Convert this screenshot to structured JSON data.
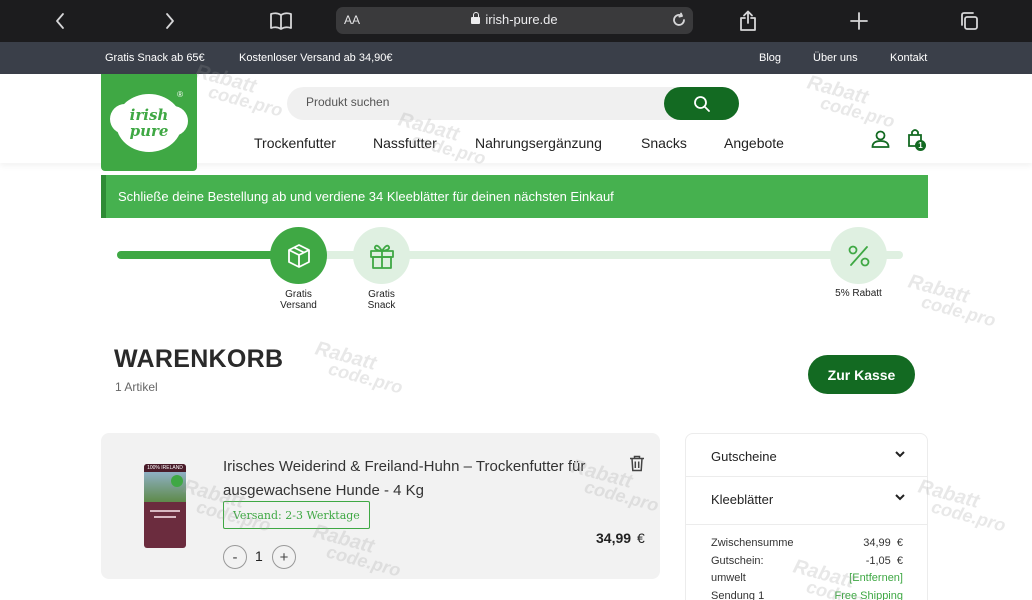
{
  "browser": {
    "url_host": "irish-pure.de",
    "text_size_label": "AA",
    "icons": [
      "chevron-left-icon",
      "chevron-right-icon",
      "book-icon",
      "lock-icon",
      "reload-icon",
      "share-icon",
      "plus-icon",
      "tabs-icon"
    ]
  },
  "promo_bar": {
    "left": [
      "Gratis Snack ab 65€",
      "Kostenloser Versand ab 34,90€"
    ],
    "right": [
      "Blog",
      "Über uns",
      "Kontakt"
    ]
  },
  "header": {
    "logo_text_1": "irish",
    "logo_text_2": "pure",
    "logo_registered": "®",
    "search_placeholder": "Produkt suchen",
    "nav": [
      "Trockenfutter",
      "Nassfutter",
      "Nahrungsergänzung",
      "Snacks",
      "Angebote"
    ],
    "cart_count": "1"
  },
  "banner": {
    "text": "Schließe deine Bestellung ab und verdiene 34 Kleeblätter für deinen nächsten Einkauf"
  },
  "progress": {
    "fill_fraction": 0.24,
    "milestones": [
      {
        "label_1": "Gratis",
        "label_2": "Versand",
        "icon": "box-icon",
        "reached": true
      },
      {
        "label_1": "Gratis",
        "label_2": "Snack",
        "icon": "gift-icon",
        "reached": false
      },
      {
        "label_1": "5% Rabatt",
        "label_2": "",
        "icon": "percent-icon",
        "reached": false
      }
    ]
  },
  "cart": {
    "title": "WARENKORB",
    "count": "1 Artikel",
    "checkout_label": "Zur Kasse"
  },
  "item": {
    "name": "Irisches Weiderind & Freiland-Huhn – Trockenfutter für ausgewachsene Hunde - 4 Kg",
    "bag_top_text": "100% IRELAND",
    "shipping": "Versand: 2-3 Werktage",
    "quantity": "1",
    "price": "34,99",
    "currency": "€"
  },
  "summary": {
    "vouchers_label": "Gutscheine",
    "clover_label": "Kleeblätter",
    "rows": [
      {
        "label": "Zwischensumme",
        "value": "34,99  €"
      },
      {
        "label": "Gutschein:",
        "value": "-1,05  €"
      },
      {
        "label": "umwelt",
        "value": "[Entfernen]"
      },
      {
        "label": "Sendung 1",
        "value": "Free Shipping"
      }
    ]
  },
  "watermark": {
    "line1": "Rabatt",
    "line2": "code.pro"
  }
}
